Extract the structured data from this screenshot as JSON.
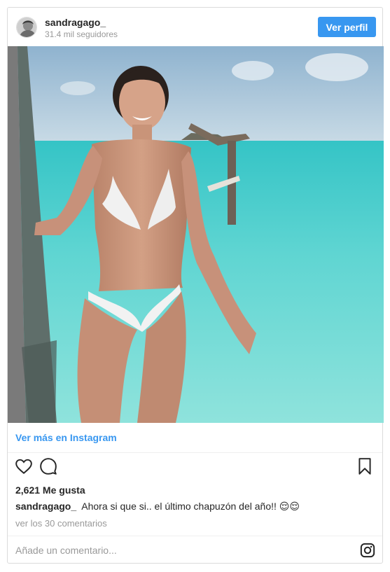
{
  "header": {
    "username": "sandragago_",
    "followers": "31.4 mil seguidores",
    "view_profile_label": "Ver perfil"
  },
  "photo": {
    "alt": "Woman in white bikini standing in turquoise water"
  },
  "see_more": {
    "label": "Ver más en Instagram"
  },
  "actions": {
    "like_icon": "heart-icon",
    "comment_icon": "comment-icon",
    "save_icon": "bookmark-icon"
  },
  "likes": {
    "text": "2,621 Me gusta"
  },
  "caption": {
    "user": "sandragago_",
    "text": "Ahora si que si.. el último chapuzón del año!! 😌😌"
  },
  "comments": {
    "link_text": "ver los 30 comentarios"
  },
  "comment_box": {
    "placeholder": "Añade un comentario...",
    "icon": "instagram-icon"
  },
  "colors": {
    "accent": "#3897f0",
    "border": "#dbdbdb",
    "muted": "#999999"
  }
}
